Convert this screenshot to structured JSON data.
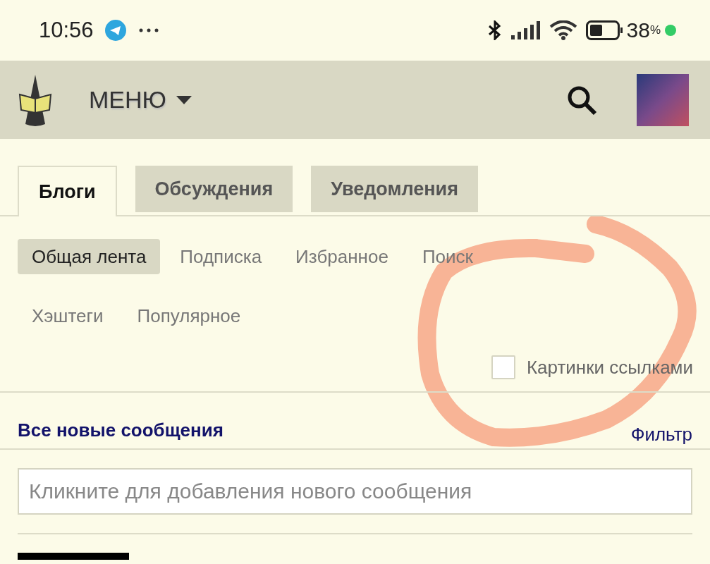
{
  "status_bar": {
    "time": "10:56",
    "battery_percent": "38",
    "percent_sign": "%"
  },
  "header": {
    "menu_label": "МЕНЮ"
  },
  "tabs": [
    {
      "label": "Блоги",
      "selected": true
    },
    {
      "label": "Обсуждения",
      "selected": false
    },
    {
      "label": "Уведомления",
      "selected": false
    }
  ],
  "subnav": [
    {
      "label": "Общая лента",
      "selected": true
    },
    {
      "label": "Подписка",
      "selected": false
    },
    {
      "label": "Избранное",
      "selected": false
    },
    {
      "label": "Поиск",
      "selected": false
    },
    {
      "label": "Хэштеги",
      "selected": false
    },
    {
      "label": "Популярное",
      "selected": false
    }
  ],
  "images_as_links": {
    "label": "Картинки ссылками",
    "checked": false
  },
  "feed": {
    "title": "Все новые сообщения",
    "filter_link": "Фильтр"
  },
  "compose": {
    "placeholder": "Кликните для добавления нового сообщения"
  }
}
